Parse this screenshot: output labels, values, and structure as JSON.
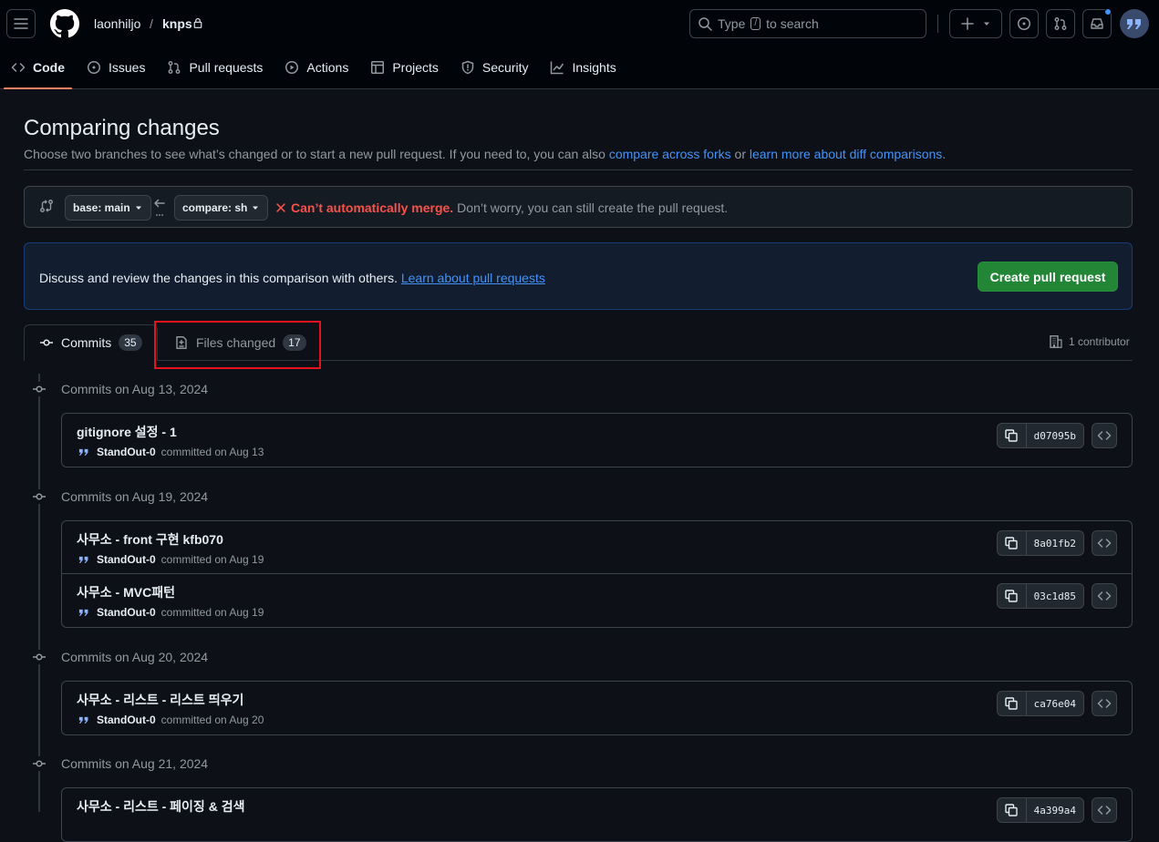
{
  "header": {
    "owner": "laonhiljo",
    "separator": "/",
    "repo": "knps",
    "search_prefix": "Type",
    "search_key": "/",
    "search_suffix": "to search"
  },
  "nav": [
    {
      "label": "Code",
      "icon": "code-icon",
      "active": true
    },
    {
      "label": "Issues",
      "icon": "issue-icon"
    },
    {
      "label": "Pull requests",
      "icon": "pull-request-icon"
    },
    {
      "label": "Actions",
      "icon": "play-icon"
    },
    {
      "label": "Projects",
      "icon": "table-icon"
    },
    {
      "label": "Security",
      "icon": "shield-icon"
    },
    {
      "label": "Insights",
      "icon": "graph-icon"
    }
  ],
  "page": {
    "title": "Comparing changes",
    "subtitle_text": "Choose two branches to see what’s changed or to start a new pull request. If you need to, you can also",
    "link_forks": "compare across forks",
    "or": "or",
    "link_learn": "learn more about diff comparisons",
    "period": "."
  },
  "range": {
    "base": "base: main",
    "compare": "compare: sh",
    "error": "Can’t automatically merge.",
    "note": "Don’t worry, you can still create the pull request."
  },
  "flash": {
    "text": "Discuss and review the changes in this comparison with others.",
    "link": "Learn about pull requests",
    "button": "Create pull request"
  },
  "tabs": {
    "commits_label": "Commits",
    "commits_count": "35",
    "files_label": "Files changed",
    "files_count": "17",
    "contributors": "1 contributor"
  },
  "groups": [
    {
      "date": "Commits on Aug 13, 2024",
      "commits": [
        {
          "message": "gitignore 설정 - 1",
          "author": "StandOut-0",
          "when": "committed on Aug 13",
          "sha": "d07095b"
        }
      ]
    },
    {
      "date": "Commits on Aug 19, 2024",
      "commits": [
        {
          "message": "사무소 - front 구현 kfb070",
          "author": "StandOut-0",
          "when": "committed on Aug 19",
          "sha": "8a01fb2"
        },
        {
          "message": "사무소 - MVC패턴",
          "author": "StandOut-0",
          "when": "committed on Aug 19",
          "sha": "03c1d85"
        }
      ]
    },
    {
      "date": "Commits on Aug 20, 2024",
      "commits": [
        {
          "message": "사무소 - 리스트 - 리스트 띄우기",
          "author": "StandOut-0",
          "when": "committed on Aug 20",
          "sha": "ca76e04"
        }
      ]
    },
    {
      "date": "Commits on Aug 21, 2024",
      "commits": [
        {
          "message": "사무소 - 리스트 - 페이징 & 검색",
          "author": "",
          "when": "",
          "sha": "4a399a4"
        }
      ]
    }
  ]
}
